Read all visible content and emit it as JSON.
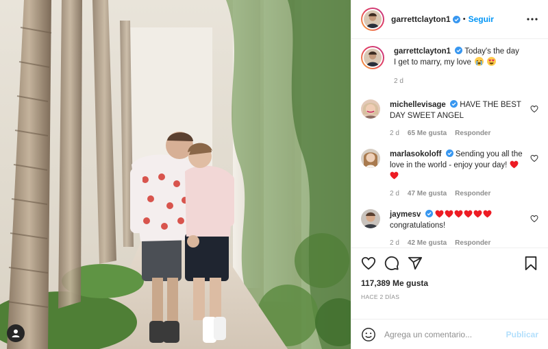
{
  "post": {
    "author": "garrettclayton1",
    "follow_label": "Seguir",
    "separator": "•",
    "caption": {
      "username": "garrettclayton1",
      "text": "Today's the day I get to marry, my love",
      "emojis": [
        "crying-face-emoji",
        "heart-eyes-emoji"
      ],
      "age": "2 d"
    },
    "comments": [
      {
        "username": "michellevisage",
        "verified": true,
        "text": "HAVE THE BEST DAY SWEET ANGEL",
        "age": "2 d",
        "likes": "65 Me gusta",
        "reply_label": "Responder"
      },
      {
        "username": "marlasokoloff",
        "verified": true,
        "text": "Sending you all the love in the world - enjoy your day!",
        "age": "2 d",
        "likes": "47 Me gusta",
        "reply_label": "Responder"
      },
      {
        "username": "jaymesv",
        "verified": true,
        "hearts": 6,
        "text": "congratulations!",
        "age": "2 d",
        "likes": "42 Me gusta",
        "reply_label": "Responder"
      }
    ],
    "likes_count": "117,389 Me gusta",
    "time_ago": "HACE 2 DÍAS",
    "comment_placeholder": "Agrega un comentario...",
    "publish_label": "Publicar"
  },
  "icons": {
    "more": "more-options-icon",
    "like": "heart-icon",
    "comment": "comment-icon",
    "share": "paper-plane-icon",
    "save": "bookmark-icon",
    "emoji": "smiley-icon",
    "tag": "user-tag-icon"
  },
  "colors": {
    "accent": "#0095f6",
    "publish_disabled": "#b2dffc",
    "verified": "#3897f0",
    "heart_red": "#ed1c24",
    "muted_text": "#8e8e8e"
  }
}
